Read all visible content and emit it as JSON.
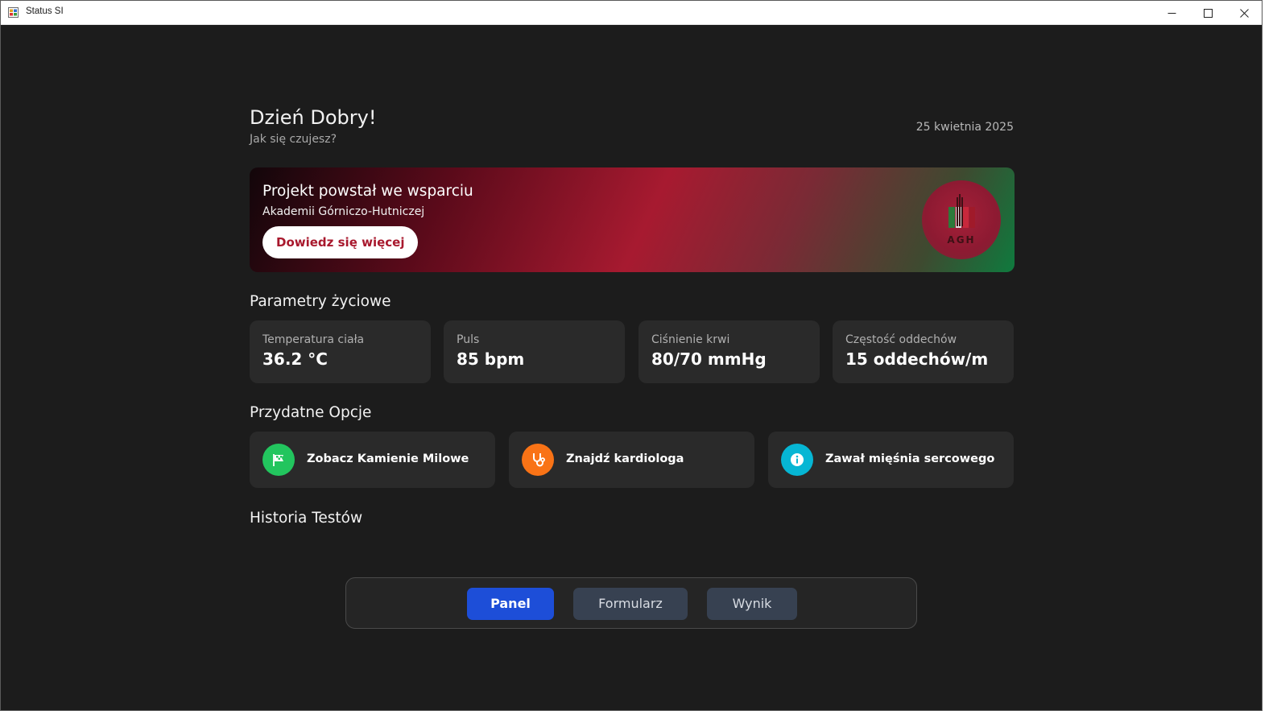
{
  "window": {
    "title": "Status SI"
  },
  "header": {
    "greeting": "Dzień Dobry!",
    "subtitle": "Jak się czujesz?",
    "date": "25 kwietnia 2025"
  },
  "banner": {
    "title": "Projekt powstał we wsparciu",
    "subtitle": "Akademii Górniczo-Hutniczej",
    "button_label": "Dowiedz się więcej",
    "logo_text": "AGH",
    "colors": {
      "dark": "#12060a",
      "red": "#a71a30",
      "green": "#0f7a3e"
    }
  },
  "vitals": {
    "title": "Parametry życiowe",
    "items": [
      {
        "label": "Temperatura ciała",
        "value": "36.2 °C"
      },
      {
        "label": "Puls",
        "value": "85 bpm"
      },
      {
        "label": "Ciśnienie krwi",
        "value": "80/70 mmHg"
      },
      {
        "label": "Częstość oddechów",
        "value": "15 oddechów/m"
      }
    ]
  },
  "options": {
    "title": "Przydatne Opcje",
    "items": [
      {
        "label": "Zobacz Kamienie Milowe",
        "icon": "flag-icon",
        "color": "#22c55e"
      },
      {
        "label": "Znajdź kardiologa",
        "icon": "stethoscope-icon",
        "color": "#f97316"
      },
      {
        "label": "Zawał mięśnia sercowego",
        "icon": "info-icon",
        "color": "#06b6d4"
      }
    ]
  },
  "history": {
    "title": "Historia Testów"
  },
  "nav": {
    "tabs": [
      {
        "label": "Panel",
        "active": true
      },
      {
        "label": "Formularz",
        "active": false
      },
      {
        "label": "Wynik",
        "active": false
      }
    ],
    "active_color": "#1d4ed8",
    "inactive_color": "#374151"
  }
}
